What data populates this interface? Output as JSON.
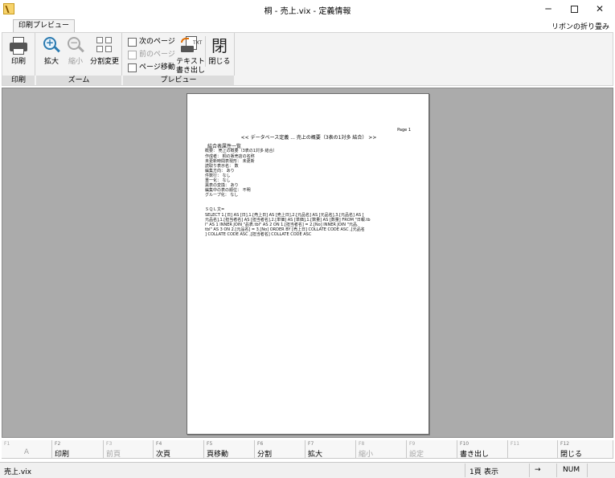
{
  "window": {
    "title": "桐 - 売上.vix - 定義情報",
    "minimize": "─",
    "close": "✕"
  },
  "ribbon": {
    "tab": "印刷プレビュー",
    "fold": "リボンの折り畳み",
    "groups": {
      "print": {
        "label": "印刷",
        "buttons": {
          "print": "印刷"
        }
      },
      "zoom": {
        "label": "ズーム",
        "buttons": {
          "zoom_in": "拡大",
          "zoom_out": "縮小",
          "split": "分割変更"
        }
      },
      "preview": {
        "label": "プレビュー",
        "buttons": {
          "next_page": "次のページ",
          "prev_page": "前のページ",
          "goto_page": "ページ移動",
          "text_export_1": "テキスト",
          "text_export_2": "書き出し",
          "close": "閉じる",
          "close_icon": "閉"
        }
      }
    }
  },
  "preview": {
    "page_label": "Page 1",
    "header": "<< データベース定義 ... 売上の概要（3表の1対多 結合） >>",
    "lines": [
      "結合表属性一覧",
      "概要：  売上の概要（3表の1対多 結合）",
      "作成者：  桐の販売店の名称",
      "未更新時間表現形：  未更新",
      "読取り表示名：  数",
      "編集方向：  あり",
      "件数行：  なし",
      "重一化：  なし",
      "異表の変換：  あり",
      "編集中の表の順位：  不明",
      "グループ化：  なし",
      "",
      "ＳＱＬ文=",
      "SELECT 1.[日] AS [日],1.[売上日] AS [売上日],2.[元品名] AS [元品名],3.[元品名] AS [",
      "元品名],1.[担当者名] AS [担当者名],2.[単価] AS [単価],1.[数量] AS [数量] FROM \"日報.tb",
      "l\" AS 1 INNER JOIN \"品表.tbl\" AS 2 ON 1.[担当者名] = 2.[No] INNER JOIN \"元品.",
      "tbl\" AS 3 ON 2.[元品名] = 3.[No] ORDER BY [売上日] COLLATE CODE ASC ,[元品名",
      "] COLLATE CODE ASC ,[担当者名] COLLATE CODE ASC"
    ]
  },
  "fkeys": [
    {
      "key": "F1",
      "label": "A",
      "enabled": false
    },
    {
      "key": "F2",
      "label": "印刷",
      "enabled": true
    },
    {
      "key": "F3",
      "label": "前頁",
      "enabled": false
    },
    {
      "key": "F4",
      "label": "次頁",
      "enabled": true
    },
    {
      "key": "F5",
      "label": "頁移動",
      "enabled": true
    },
    {
      "key": "F6",
      "label": "分割",
      "enabled": true
    },
    {
      "key": "F7",
      "label": "拡大",
      "enabled": true
    },
    {
      "key": "F8",
      "label": "縮小",
      "enabled": false
    },
    {
      "key": "F9",
      "label": "設定",
      "enabled": false
    },
    {
      "key": "F10",
      "label": "書き出し",
      "enabled": true
    },
    {
      "key": "F11",
      "label": "",
      "enabled": false
    },
    {
      "key": "F12",
      "label": "閉じる",
      "enabled": true
    }
  ],
  "status": {
    "file": "売上.vix",
    "page": "1頁",
    "mode": "表示",
    "arrow": "→",
    "num": "NUM"
  }
}
